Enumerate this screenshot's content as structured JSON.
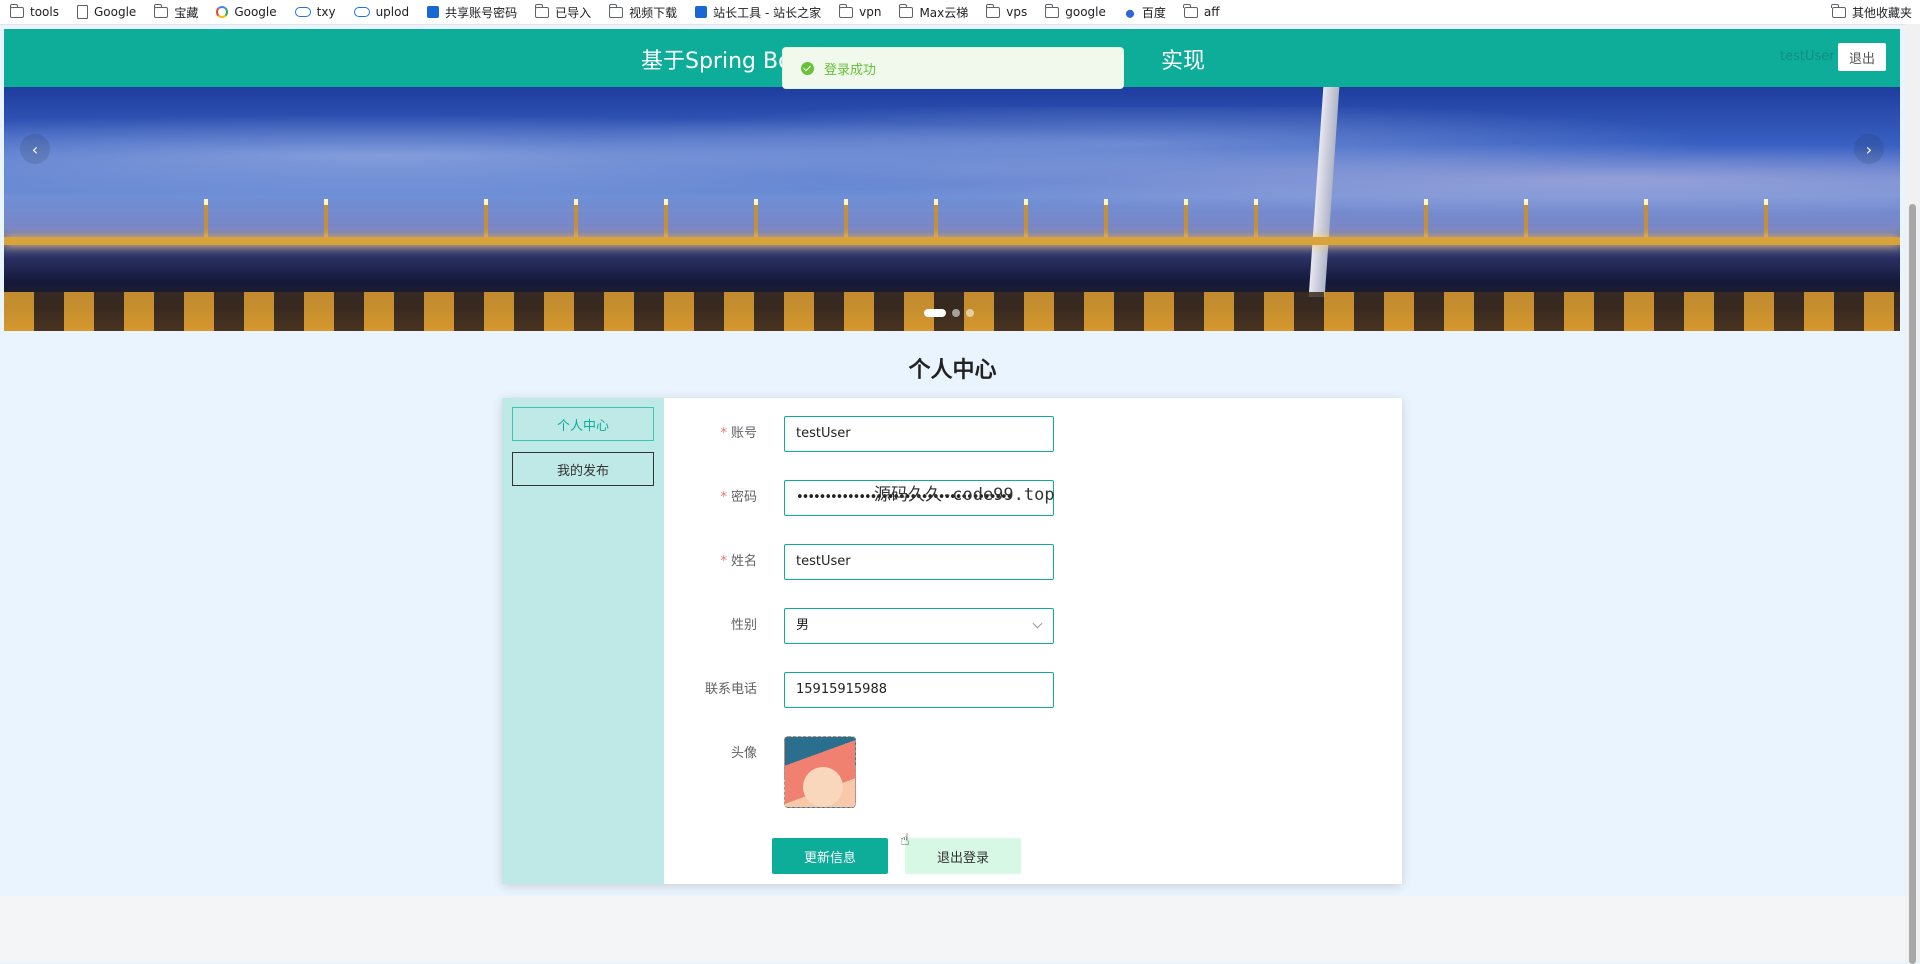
{
  "bookmarks": {
    "items": [
      "tools",
      "Google",
      "宝藏",
      "Google",
      "txy",
      "uplod",
      "共享账号密码",
      "已导入",
      "视频下载",
      "站长工具 - 站长之家",
      "vpn",
      "Max云梯",
      "vps",
      "google",
      "百度",
      "aff"
    ],
    "other": "其他收藏夹"
  },
  "header": {
    "title": "基于Spring Boot                                              实现",
    "title_left": "基于Spring Boo",
    "title_right": "实现",
    "user": "testUser",
    "logout": "退出"
  },
  "toast": {
    "message": "登录成功",
    "color": "#67c23a"
  },
  "page": {
    "title": "个人中心"
  },
  "sidebar": {
    "items": [
      {
        "label": "个人中心"
      },
      {
        "label": "我的发布"
      }
    ]
  },
  "form": {
    "account": {
      "label": "账号",
      "value": "testUser",
      "required": true
    },
    "password": {
      "label": "密码",
      "value": "••••••••••••••••••••••••••••••••••••••",
      "required": true
    },
    "name": {
      "label": "姓名",
      "value": "testUser",
      "required": true
    },
    "gender": {
      "label": "性别",
      "value": "男"
    },
    "phone": {
      "label": "联系电话",
      "value": "15915915988"
    },
    "avatar": {
      "label": "头像"
    },
    "required_mark": "*"
  },
  "buttons": {
    "update": "更新信息",
    "logout": "退出登录"
  },
  "watermark": "源码久久-code99.top",
  "carousel": {
    "slide_count": 3,
    "active_index": 0,
    "prev": "‹",
    "next": "›"
  },
  "colors": {
    "primary": "#0ead9a",
    "sidebar": "#bfe9e6",
    "background": "#eaf4fe"
  }
}
